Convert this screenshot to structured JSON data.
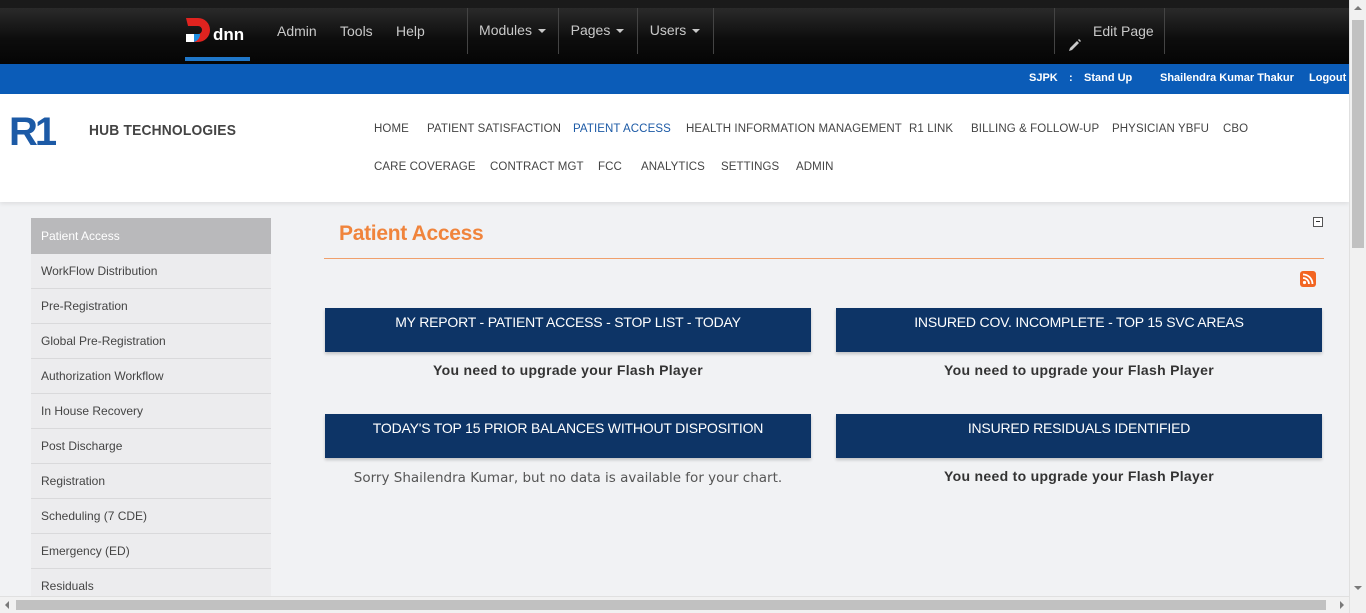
{
  "control_bar": {
    "logo_text": "dnn",
    "links": [
      "Admin",
      "Tools",
      "Help"
    ],
    "dropdowns": [
      "Modules",
      "Pages",
      "Users"
    ],
    "edit_page": "Edit Page"
  },
  "user_bar": {
    "site": "SJPK",
    "separator": ":",
    "stand_up": "Stand Up",
    "user_name": "Shailendra Kumar Thakur",
    "logout": "Logout"
  },
  "header": {
    "logo_text": "R1",
    "company": "HUB TECHNOLOGIES",
    "menu_row1": [
      "HOME",
      "PATIENT SATISFACTION",
      "PATIENT ACCESS",
      "HEALTH INFORMATION MANAGEMENT",
      "R1 LINK",
      "BILLING & FOLLOW-UP",
      "PHYSICIAN YBFU",
      "CBO"
    ],
    "menu_row2": [
      "CARE COVERAGE",
      "CONTRACT MGT",
      "FCC",
      "ANALYTICS",
      "SETTINGS",
      "ADMIN"
    ],
    "active_item": "PATIENT ACCESS"
  },
  "sidebar": {
    "title": "Patient Access",
    "items": [
      "WorkFlow Distribution",
      "Pre-Registration",
      "Global Pre-Registration",
      "Authorization Workflow",
      "In House Recovery",
      "Post Discharge",
      "Registration",
      "Scheduling (7 CDE)",
      "Emergency (ED)",
      "Residuals"
    ]
  },
  "main": {
    "title": "Patient Access",
    "panels": [
      {
        "title": "MY REPORT - PATIENT ACCESS - STOP LIST - TODAY",
        "message": "You need to upgrade your Flash Player"
      },
      {
        "title": "INSURED COV. INCOMPLETE - TOP 15 SVC AREAS",
        "message": "You need to upgrade your Flash Player"
      },
      {
        "title": "TODAY'S TOP 15 PRIOR BALANCES WITHOUT DISPOSITION",
        "message": "Sorry Shailendra Kumar, but no data is available for your chart."
      },
      {
        "title": "INSURED RESIDUALS IDENTIFIED",
        "message": "You need to upgrade your Flash Player"
      }
    ]
  },
  "colors": {
    "brand_blue": "#0b5cb8",
    "panel_navy": "#0d3466",
    "title_orange": "#f0843c",
    "r1_blue": "#1c5aa6"
  }
}
